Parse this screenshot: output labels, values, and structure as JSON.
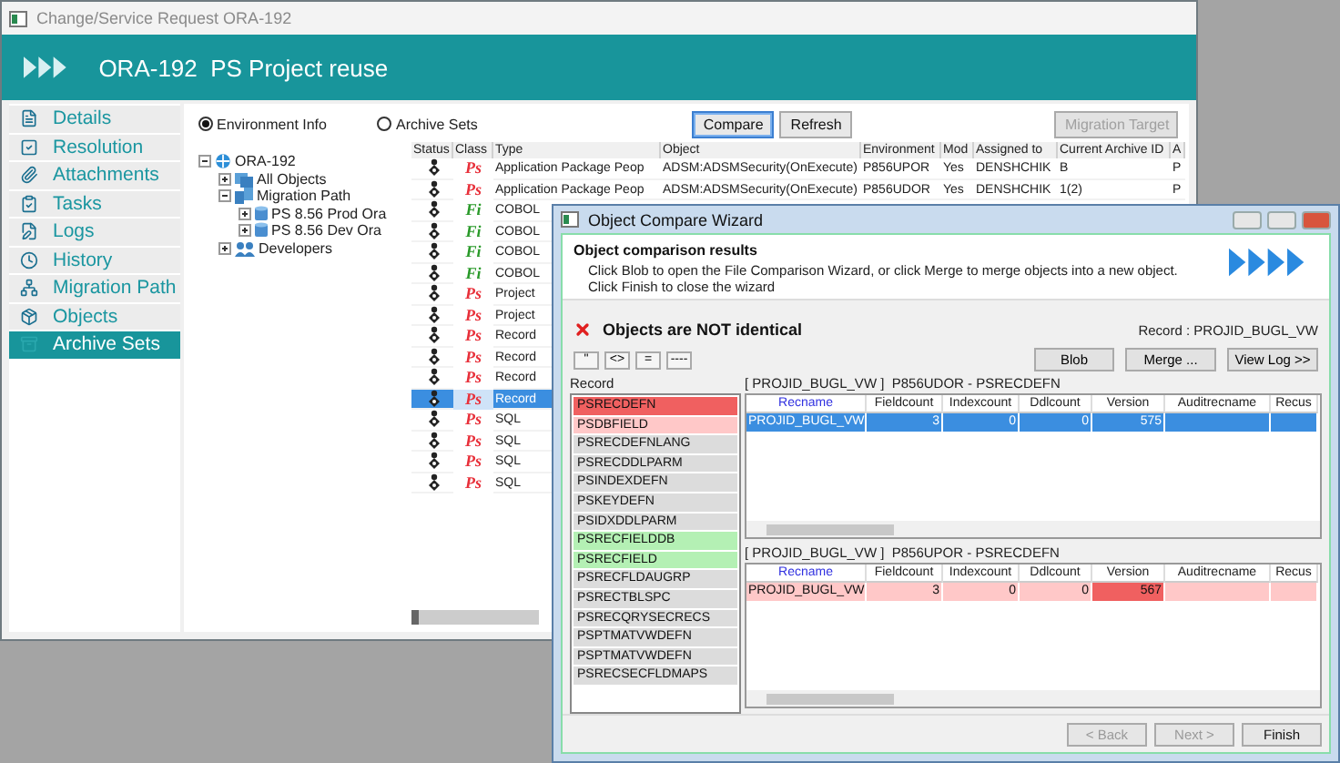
{
  "main_window": {
    "title": "Change/Service Request ORA-192",
    "header": {
      "id": "ORA-192",
      "title": "PS Project reuse"
    },
    "sidebar": {
      "items": [
        {
          "label": "Details",
          "selected": false
        },
        {
          "label": "Resolution",
          "selected": false
        },
        {
          "label": "Attachments",
          "selected": false
        },
        {
          "label": "Tasks",
          "selected": false
        },
        {
          "label": "Logs",
          "selected": false
        },
        {
          "label": "History",
          "selected": false
        },
        {
          "label": "Migration Path",
          "selected": false
        },
        {
          "label": "Objects",
          "selected": false
        },
        {
          "label": "Archive Sets",
          "selected": true
        }
      ]
    },
    "view_options": [
      {
        "label": "Environment Info",
        "selected": true
      },
      {
        "label": "Archive Sets",
        "selected": false
      }
    ],
    "tree": [
      {
        "label": "ORA-192",
        "kind": "project",
        "expanded": true,
        "children": [
          {
            "label": "All Objects",
            "kind": "objects",
            "expanded": false
          },
          {
            "label": "Migration Path",
            "kind": "path",
            "expanded": true,
            "children": [
              {
                "label": "PS 8.56 Prod Ora",
                "kind": "database",
                "expanded": false
              },
              {
                "label": "PS 8.56 Dev Ora",
                "kind": "database",
                "expanded": false
              }
            ]
          },
          {
            "label": "Developers",
            "kind": "people",
            "expanded": false
          }
        ]
      }
    ],
    "buttons": [
      {
        "label": "Compare",
        "focused": true,
        "disabled": false
      },
      {
        "label": "Refresh",
        "focused": false,
        "disabled": false
      }
    ],
    "target_button": {
      "label": "Migration Target",
      "disabled": true
    },
    "table": {
      "columns": [
        "Status",
        "Class",
        "Type",
        "Object",
        "Environment",
        "Mod",
        "Assigned to",
        "Current Archive ID",
        "A"
      ],
      "rows": [
        {
          "class": "Ps",
          "color": "#e8303a",
          "type": "Application Package Peop",
          "object": "ADSM:ADSMSecurity(OnExecute)",
          "environment": "P856UPOR",
          "mod": "Yes",
          "assigned_to": "DENSHCHIK",
          "archive_id": "B",
          "column_9": "P",
          "selected": false
        },
        {
          "class": "Ps",
          "color": "#e8303a",
          "type": "Application Package Peop",
          "object": "ADSM:ADSMSecurity(OnExecute)",
          "environment": "P856UDOR",
          "mod": "Yes",
          "assigned_to": "DENSHCHIK",
          "archive_id": "1(2)",
          "column_9": "P",
          "selected": false
        },
        {
          "class": "Fi",
          "color": "#2a9a2a",
          "type": "COBOL",
          "selected": false
        },
        {
          "class": "Fi",
          "color": "#2a9a2a",
          "type": "COBOL",
          "selected": false
        },
        {
          "class": "Fi",
          "color": "#2a9a2a",
          "type": "COBOL",
          "selected": false
        },
        {
          "class": "Fi",
          "color": "#2a9a2a",
          "type": "COBOL",
          "selected": false
        },
        {
          "class": "Ps",
          "color": "#e8303a",
          "type": "Project",
          "selected": false
        },
        {
          "class": "Ps",
          "color": "#e8303a",
          "type": "Project",
          "selected": false
        },
        {
          "class": "Ps",
          "color": "#e8303a",
          "type": "Record",
          "selected": false
        },
        {
          "class": "Ps",
          "color": "#e8303a",
          "type": "Record",
          "selected": false
        },
        {
          "class": "Ps",
          "color": "#e8303a",
          "type": "Record",
          "selected": false
        },
        {
          "class": "Ps",
          "color": "#e8303a",
          "type": "Record",
          "selected": true
        },
        {
          "class": "Ps",
          "color": "#e8303a",
          "type": "SQL",
          "selected": false
        },
        {
          "class": "Ps",
          "color": "#e8303a",
          "type": "SQL",
          "selected": false
        },
        {
          "class": "Ps",
          "color": "#e8303a",
          "type": "SQL",
          "selected": false
        },
        {
          "class": "Ps",
          "color": "#e8303a",
          "type": "SQL",
          "selected": false
        }
      ]
    }
  },
  "wizard": {
    "title": "Object Compare Wizard",
    "heading": "Object comparison results",
    "instructions": [
      "Click Blob to open the File Comparison Wizard, or click Merge to merge objects into a new object.",
      "Click Finish to close the wizard"
    ],
    "result": "Objects are NOT identical",
    "record": "Record : PROJID_BUGL_VW",
    "filter_buttons": [
      "\"",
      "<>",
      "=",
      "----"
    ],
    "action_buttons": [
      "Blob",
      "Merge ...",
      "View Log >>"
    ],
    "list_label": "Record",
    "records": [
      {
        "name": "PSRECDEFN",
        "color": "#f06060"
      },
      {
        "name": "PSDBFIELD",
        "color": "#ffc8c8"
      },
      {
        "name": "PSRECDEFNLANG",
        "color": "#dcdcdc"
      },
      {
        "name": "PSRECDDLPARM",
        "color": "#dcdcdc"
      },
      {
        "name": "PSINDEXDEFN",
        "color": "#dcdcdc"
      },
      {
        "name": "PSKEYDEFN",
        "color": "#dcdcdc"
      },
      {
        "name": "PSIDXDDLPARM",
        "color": "#dcdcdc"
      },
      {
        "name": "PSRECFIELDDB",
        "color": "#b4f0b4"
      },
      {
        "name": "PSRECFIELD",
        "color": "#b4f0b4"
      },
      {
        "name": "PSRECFLDAUGRP",
        "color": "#dcdcdc"
      },
      {
        "name": "PSRECTBLSPC",
        "color": "#dcdcdc"
      },
      {
        "name": "PSRECQRYSECRECS",
        "color": "#dcdcdc"
      },
      {
        "name": "PSPTMATVWDEFN",
        "color": "#dcdcdc"
      },
      {
        "name": "PSPTMATVWDEFN",
        "color": "#dcdcdc"
      },
      {
        "name": "PSRECSECFLDMAPS",
        "color": "#dcdcdc"
      }
    ],
    "grids": [
      {
        "caption": "[ PROJID_BUGL_VW ]  P856UDOR - PSRECDEFN",
        "columns": [
          "Recname",
          "Fieldcount",
          "Indexcount",
          "Ddlcount",
          "Version",
          "Auditrecname",
          "Recus"
        ],
        "rows": [
          {
            "selected": true,
            "cells": [
              {
                "text": "PROJID_BUGL_VW"
              },
              {
                "text": "3"
              },
              {
                "text": "0"
              },
              {
                "text": "0"
              },
              {
                "text": "575"
              }
            ]
          }
        ]
      },
      {
        "caption": "[ PROJID_BUGL_VW ]  P856UPOR - PSRECDEFN",
        "columns": [
          "Recname",
          "Fieldcount",
          "Indexcount",
          "Ddlcount",
          "Version",
          "Auditrecname",
          "Recus"
        ],
        "rows": [
          {
            "selected": false,
            "cells": [
              {
                "text": "PROJID_BUGL_VW",
                "color": "#ffc8c8"
              },
              {
                "text": "3",
                "color": "#ffc8c8"
              },
              {
                "text": "0",
                "color": "#ffc8c8"
              },
              {
                "text": "0",
                "color": "#ffc8c8"
              },
              {
                "text": "567",
                "color": "#f06060"
              },
              {
                "color": "#ffc8c8"
              },
              {
                "color": "#ffc8c8"
              }
            ]
          }
        ]
      }
    ],
    "nav_buttons": [
      {
        "label": "< Back",
        "disabled": true
      },
      {
        "label": "Next >",
        "disabled": true
      },
      {
        "label": "Finish",
        "disabled": false
      }
    ]
  }
}
